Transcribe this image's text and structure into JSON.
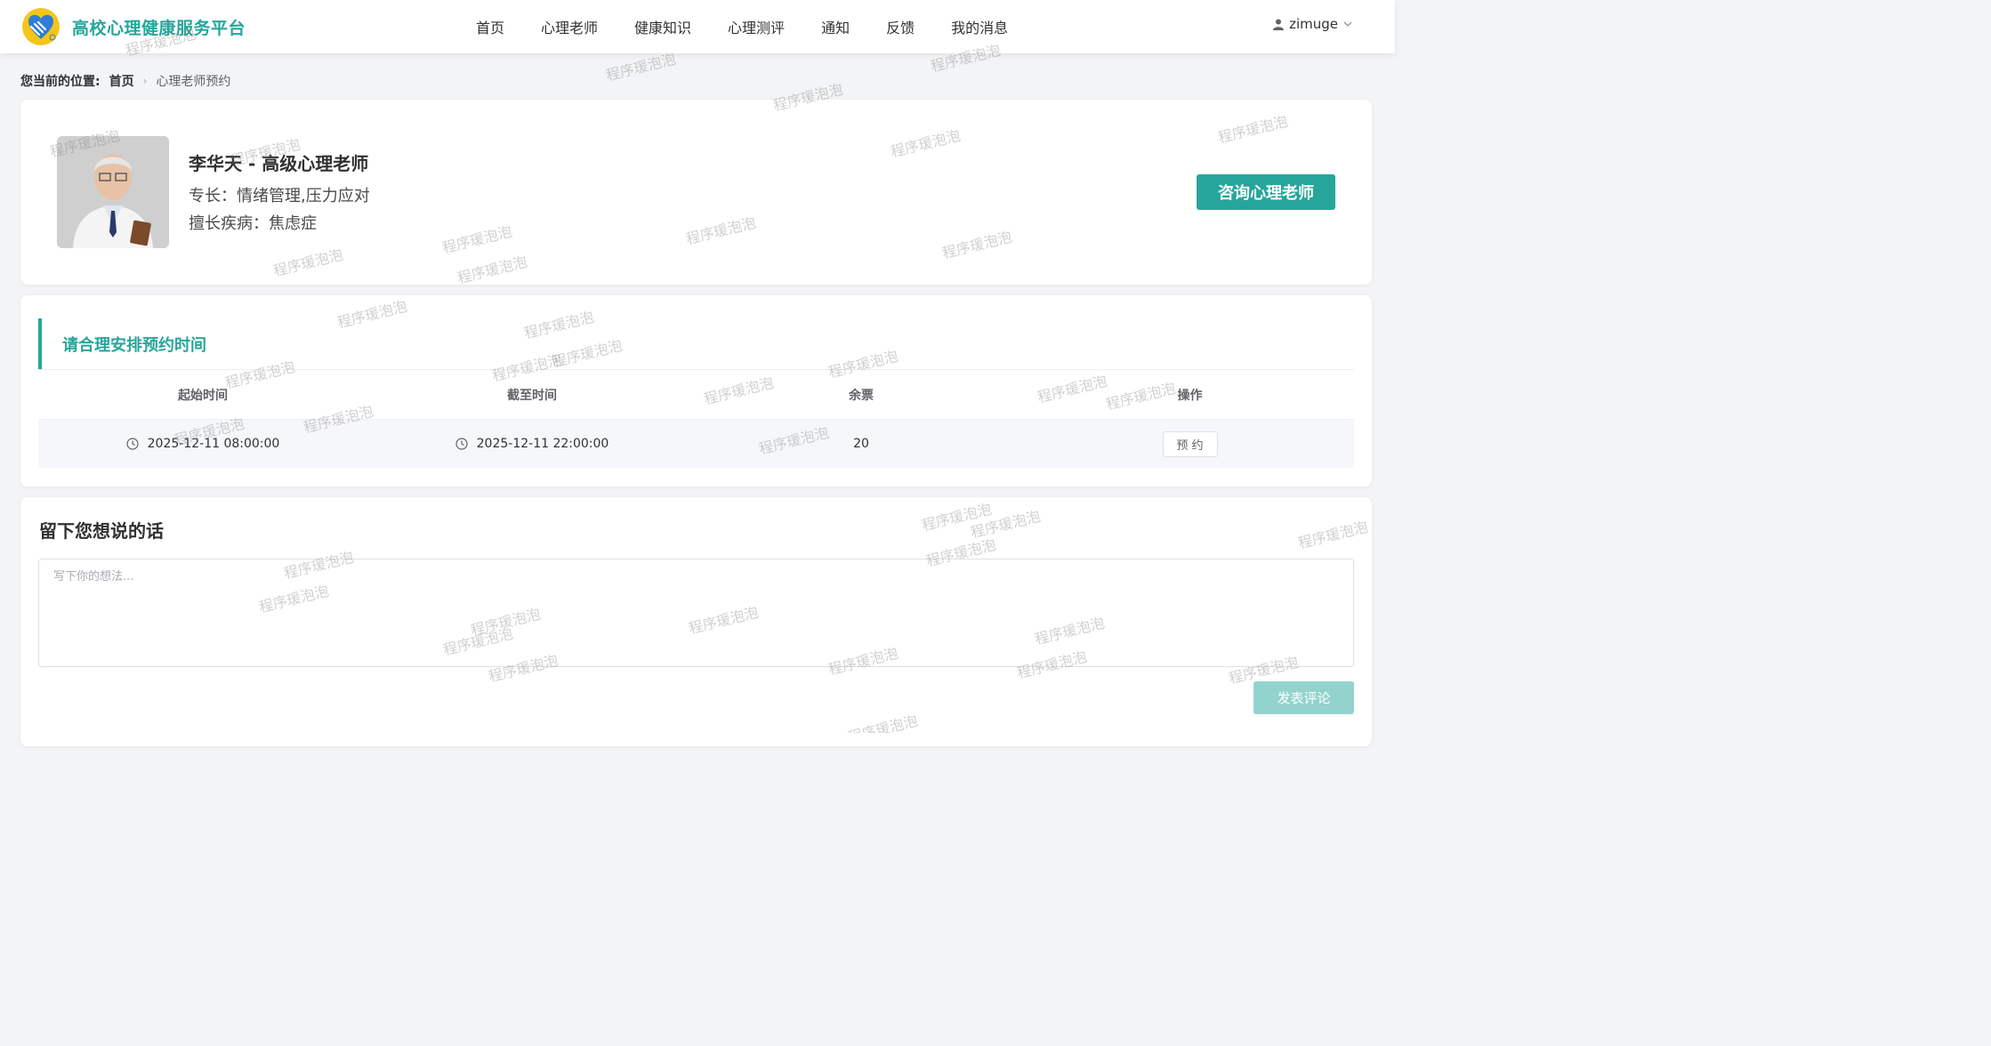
{
  "header": {
    "brand_title": "高校心理健康服务平台",
    "brand_color": "#26a69a",
    "nav": [
      {
        "label": "首页"
      },
      {
        "label": "心理老师"
      },
      {
        "label": "健康知识"
      },
      {
        "label": "心理测评"
      },
      {
        "label": "通知"
      },
      {
        "label": "反馈"
      },
      {
        "label": "我的消息"
      }
    ],
    "user": {
      "name": "zimuge",
      "icon": "user-icon",
      "dropdown_icon": "chevron-down-icon"
    }
  },
  "breadcrumb": {
    "prefix": "您当前的位置:",
    "home": "首页",
    "current": "心理老师预约"
  },
  "teacher": {
    "name_title": "李华天 - 高级心理老师",
    "specialty": "专长：情绪管理,压力应对",
    "disease": "擅长疾病：焦虑症",
    "consult_button": "咨询心理老师"
  },
  "schedule": {
    "section_title": "请合理安排预约时间",
    "columns": [
      "起始时间",
      "截至时间",
      "余票",
      "操作"
    ],
    "rows": [
      {
        "start": "2025-12-11 08:00:00",
        "end": "2025-12-11 22:00:00",
        "remaining": "20",
        "action": "预 约"
      }
    ]
  },
  "comment": {
    "title": "留下您想说的话",
    "placeholder": "写下你的想法...",
    "value": "",
    "submit_button": "发表评论"
  },
  "watermark": {
    "text": "程序瑗泡泡"
  }
}
